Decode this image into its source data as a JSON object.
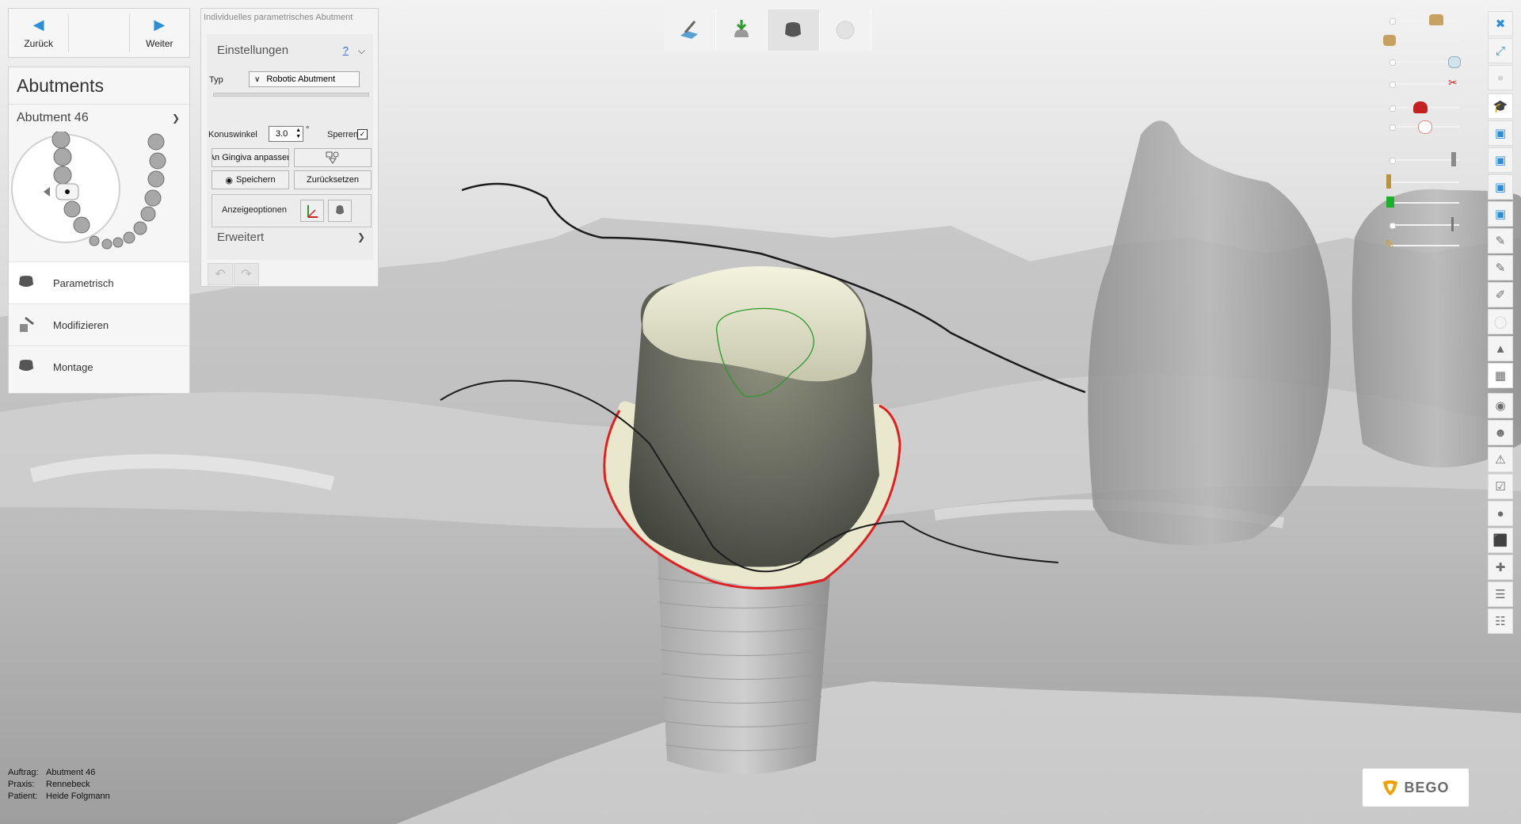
{
  "nav": {
    "back_label": "Zurück",
    "next_label": "Weiter"
  },
  "left_panel": {
    "title": "Abutments",
    "selected_abutment": "Abutment 46",
    "tools": [
      {
        "label": "Parametrisch",
        "active": true
      },
      {
        "label": "Modifizieren",
        "active": false
      },
      {
        "label": "Montage",
        "active": false
      }
    ]
  },
  "dialog": {
    "title": "Individuelles parametrisches Abutment",
    "section_settings": "Einstellungen",
    "help": "?",
    "type_label": "Typ",
    "type_value": "Robotic Abutment",
    "cone_angle_label": "Konuswinkel",
    "cone_angle_value": "3.0",
    "cone_angle_unit": "°",
    "lock_label": "Sperren",
    "fit_gingiva_button": "An Gingiva anpassen",
    "save_button": "Speichern",
    "reset_button": "Zurücksetzen",
    "display_options_label": "Anzeigeoptionen",
    "section_advanced": "Erweitert"
  },
  "info": {
    "order_key": "Auftrag:",
    "order_value": "Abutment 46",
    "practice_key": "Praxis:",
    "practice_value": "Rennebeck",
    "patient_key": "Patient:",
    "patient_value": "Heide Folgmann"
  },
  "brand": {
    "name": "BEGO",
    "accent": "#f2a000"
  },
  "colors": {
    "margin_line": "#e02020",
    "scan_line": "#1c1c1c",
    "emergence_line": "#2a9a2a",
    "nav_arrow": "#2a8fd6"
  },
  "right_toolbar_icons": [
    "close-icon",
    "fullscreen-icon",
    "sphere-icon",
    "graduation-cap-icon",
    "cube-front-icon",
    "cube-top-icon",
    "cube-side-icon",
    "cube-back-icon",
    "knife-icon",
    "knife-2-icon",
    "brush-icon",
    "tooth-dim-icon",
    "wax-icon",
    "clamp-icon",
    "crown-icon",
    "face-icon",
    "warning-icon",
    "checklist-icon",
    "camera-icon",
    "box-icon",
    "crosshair-icon",
    "ruler-icon",
    "report-icon"
  ]
}
